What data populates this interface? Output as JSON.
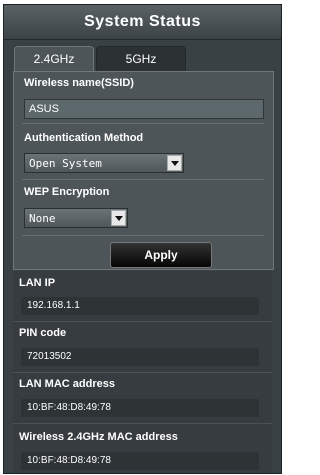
{
  "title": "System Status",
  "tabs": [
    "2.4GHz",
    "5GHz"
  ],
  "wireless": {
    "ssid_label": "Wireless name(SSID)",
    "ssid_value": "ASUS",
    "auth_label": "Authentication Method",
    "auth_value": "Open System",
    "wep_label": "WEP Encryption",
    "wep_value": "None",
    "apply_label": "Apply"
  },
  "info": {
    "lan_ip_label": "LAN IP",
    "lan_ip_value": "192.168.1.1",
    "pin_label": "PIN code",
    "pin_value": "72013502",
    "lan_mac_label": "LAN MAC address",
    "lan_mac_value": "10:BF:48:D8:49:78",
    "wl24_mac_label": "Wireless 2.4GHz MAC address",
    "wl24_mac_value": "10:BF:48:D8:49:78"
  },
  "colors": {
    "panel_bg": "#3a4144",
    "tab_active": "#4d5558",
    "field_bg": "#5d686c",
    "button_bg": "#111111"
  }
}
